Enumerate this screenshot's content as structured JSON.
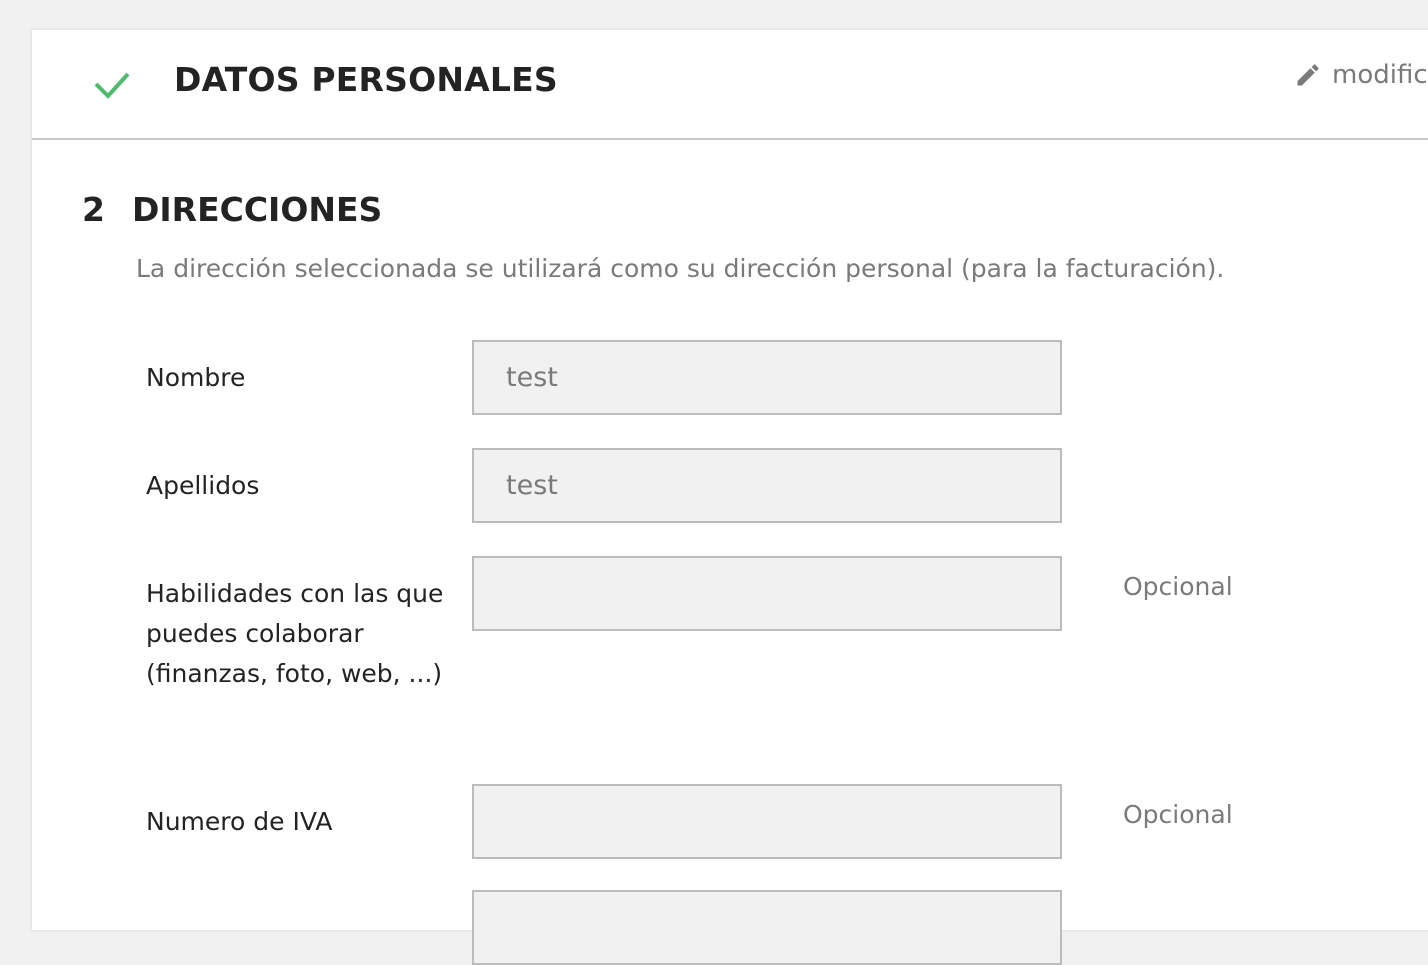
{
  "personal_step": {
    "title": "DATOS PERSONALES",
    "edit_label": "modific",
    "icons": {
      "status": "check-icon",
      "edit": "pencil-icon"
    },
    "colors": {
      "check": "#4cbb6c"
    }
  },
  "address_step": {
    "number": "2",
    "title": "DIRECCIONES",
    "description": "La dirección seleccionada se utilizará como su dirección personal (para la facturación)."
  },
  "form": {
    "first_name": {
      "label": "Nombre",
      "value": "test"
    },
    "last_name": {
      "label": "Apellidos",
      "value": "test"
    },
    "skills": {
      "label": "Habilidades con las que puedes colaborar (finanzas, foto, web, ...)",
      "value": "",
      "note": "Opcional"
    },
    "vat": {
      "label": "Numero de IVA",
      "value": "",
      "note": "Opcional"
    }
  }
}
